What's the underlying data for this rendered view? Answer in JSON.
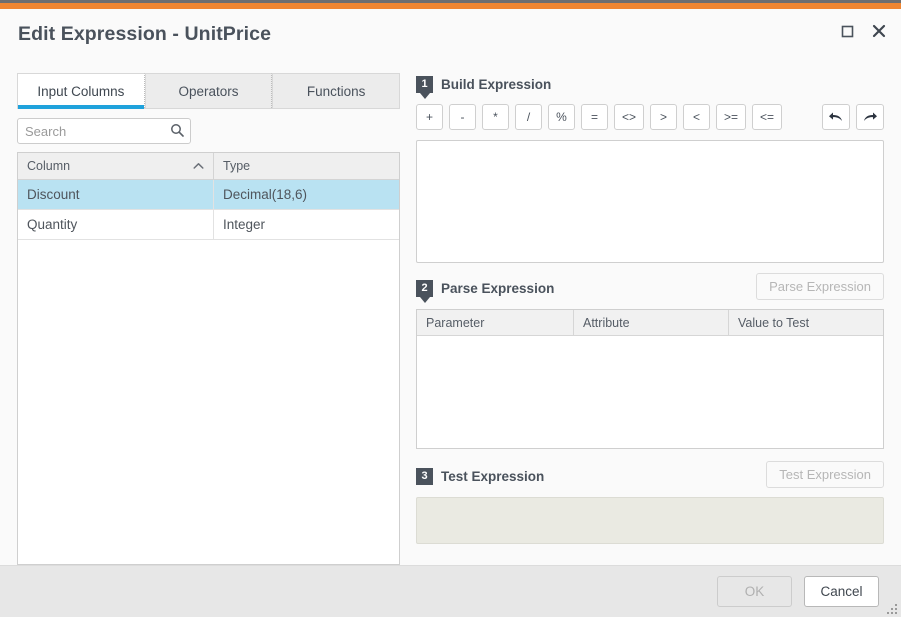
{
  "window": {
    "title": "Edit Expression - UnitPrice",
    "accent_orange": "#ef8633",
    "accent_dark": "#6d6e71",
    "controls": {
      "maximize": "maximize-icon",
      "close": "close-icon"
    }
  },
  "left_panel": {
    "tabs": [
      {
        "label": "Input Columns",
        "active": true
      },
      {
        "label": "Operators",
        "active": false
      },
      {
        "label": "Functions",
        "active": false
      }
    ],
    "search": {
      "placeholder": "Search",
      "value": "",
      "icon": "search-icon"
    },
    "grid": {
      "columns": [
        {
          "label": "Column",
          "sort": "ascending",
          "sort_icon": "chevron-up-icon"
        },
        {
          "label": "Type",
          "sort": "none"
        }
      ],
      "rows": [
        {
          "column": "Discount",
          "type": "Decimal(18,6)",
          "selected": true
        },
        {
          "column": "Quantity",
          "type": "Integer",
          "selected": false
        }
      ],
      "selected_color": "#b9e2f2"
    }
  },
  "right_panel": {
    "build": {
      "badge": "1",
      "title": "Build Expression",
      "operators": [
        {
          "label": "+",
          "name": "plus"
        },
        {
          "label": "-",
          "name": "minus"
        },
        {
          "label": "*",
          "name": "multiply"
        },
        {
          "label": "/",
          "name": "divide"
        },
        {
          "label": "%",
          "name": "modulo"
        },
        {
          "label": "=",
          "name": "equals"
        },
        {
          "label": "<>",
          "name": "not-equals"
        },
        {
          "label": ">",
          "name": "greater-than"
        },
        {
          "label": "<",
          "name": "less-than"
        },
        {
          "label": ">=",
          "name": "greater-or-equal"
        },
        {
          "label": "<=",
          "name": "less-or-equal"
        }
      ],
      "undo_icon": "undo-arrow-icon",
      "redo_icon": "redo-arrow-icon",
      "expression_value": ""
    },
    "parse": {
      "badge": "2",
      "title": "Parse Expression",
      "button_label": "Parse Expression",
      "button_enabled": false,
      "columns": [
        "Parameter",
        "Attribute",
        "Value to Test"
      ],
      "rows": []
    },
    "test": {
      "badge": "3",
      "title": "Test Expression",
      "button_label": "Test Expression",
      "button_enabled": false,
      "result_value": "",
      "result_bg": "#eaeae2"
    }
  },
  "footer": {
    "ok_label": "OK",
    "ok_enabled": false,
    "cancel_label": "Cancel",
    "resize_grip": "resize-grip-icon"
  }
}
